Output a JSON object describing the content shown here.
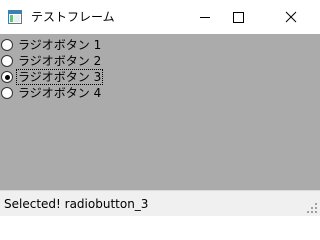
{
  "window": {
    "title": "テストフレーム"
  },
  "icons": {
    "app": "app-window-icon",
    "minimize": "minimize-icon",
    "maximize": "maximize-icon",
    "close": "close-icon",
    "size_grip": "size-grip-icon"
  },
  "radio_group": {
    "items": [
      {
        "label": "ラジオボタン 1",
        "checked": false
      },
      {
        "label": "ラジオボタン 2",
        "checked": false
      },
      {
        "label": "ラジオボタン 3",
        "checked": true
      },
      {
        "label": "ラジオボタン 4",
        "checked": false
      }
    ]
  },
  "status": {
    "text": "Selected! radiobutton_3"
  },
  "colors": {
    "client_background": "#ababab",
    "titlebar_background": "#ffffff",
    "statusbar_background": "#f0f0f0"
  }
}
